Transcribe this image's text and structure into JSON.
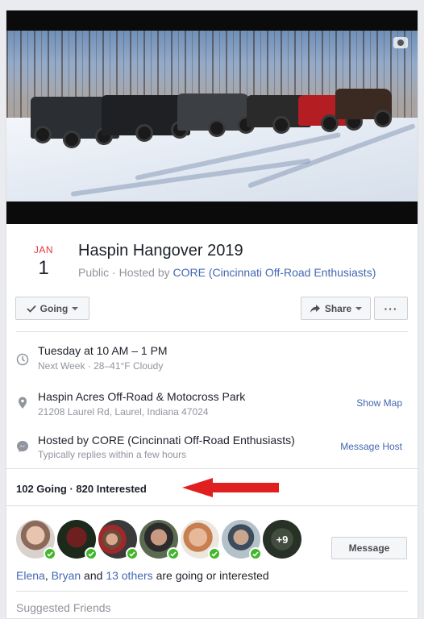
{
  "event": {
    "date_month": "JAN",
    "date_day": "1",
    "title": "Haspin Hangover 2019",
    "privacy": "Public",
    "hosted_by_prefix": " · Hosted by ",
    "host_name": "CORE (Cincinnati Off-Road Enthusiasts)"
  },
  "actions": {
    "going_label": "Going",
    "share_label": "Share",
    "more_label": "···"
  },
  "time": {
    "main": "Tuesday at 10 AM – 1 PM",
    "sub": "Next Week · 28–41°F Cloudy"
  },
  "location": {
    "main": "Haspin Acres Off-Road & Motocross Park",
    "sub": "21208 Laurel Rd, Laurel, Indiana 47024",
    "action": "Show Map"
  },
  "host": {
    "main": "Hosted by CORE (Cincinnati Off-Road Enthusiasts)",
    "sub": "Typically replies within a few hours",
    "action": "Message Host"
  },
  "stats": {
    "text": "102 Going · 820 Interested"
  },
  "attendees": {
    "more_count": "+9",
    "message_label": "Message",
    "friend_1": "Elena",
    "separator": ", ",
    "friend_2": "Bryan",
    "and_text": " and ",
    "others_text": "13 others",
    "suffix_text": " are going or interested"
  },
  "suggested": {
    "label": "Suggested Friends"
  },
  "colors": {
    "link": "#4267b2",
    "date_red": "#e0393e",
    "badge_green": "#42b72a",
    "annotation_arrow": "#e02020"
  },
  "icons": {
    "cover": "camera-icon",
    "going": "checkmark-icon",
    "share": "share-arrow-icon",
    "time": "clock-icon",
    "location": "map-pin-icon",
    "host": "messenger-icon"
  }
}
